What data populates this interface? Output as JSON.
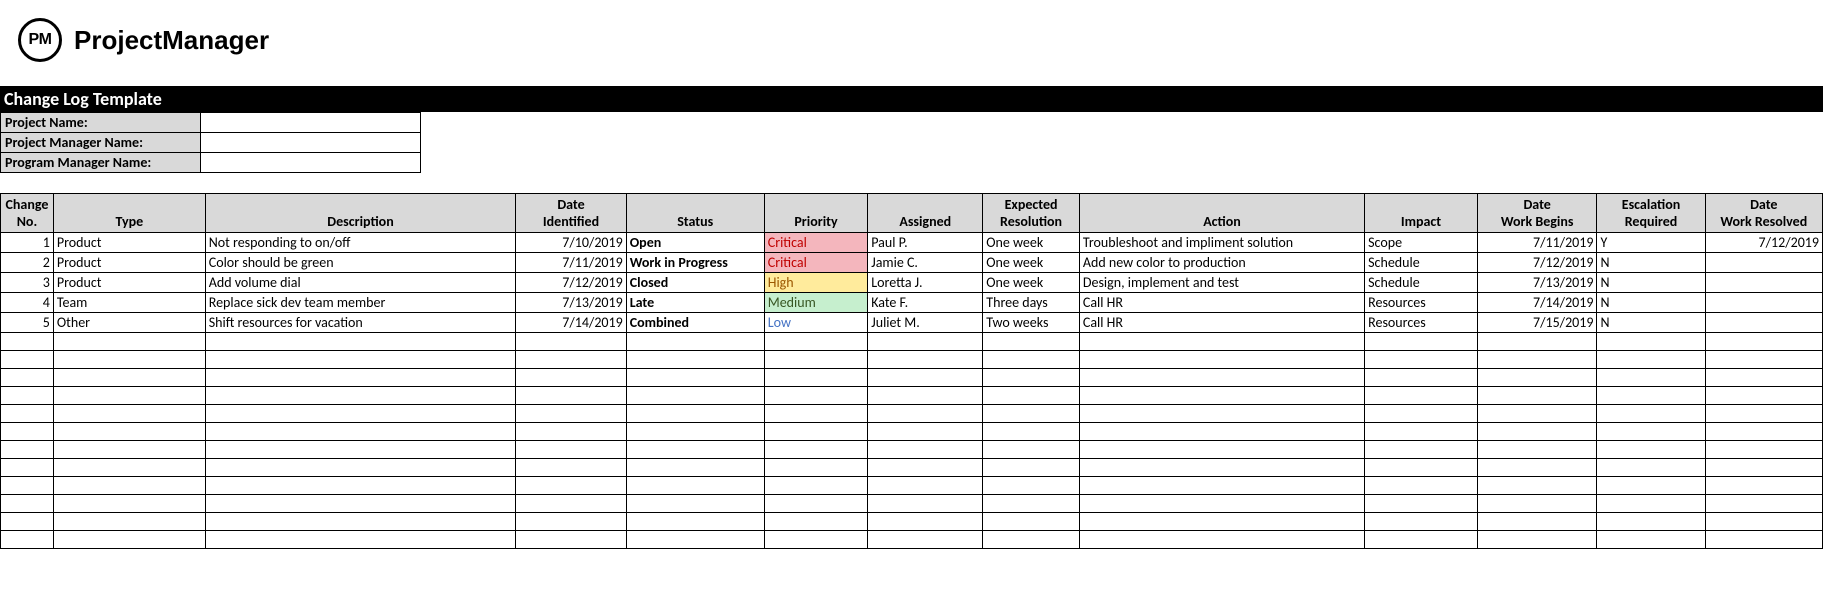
{
  "brand": {
    "logoText": "PM",
    "name": "ProjectManager"
  },
  "title": "Change Log Template",
  "meta": {
    "fields": [
      {
        "label": "Project Name:",
        "value": ""
      },
      {
        "label": "Project Manager Name:",
        "value": ""
      },
      {
        "label": "Program Manager Name:",
        "value": ""
      }
    ]
  },
  "columns": [
    "Change No.",
    "Type",
    "Description",
    "Date Identified",
    "Status",
    "Priority",
    "Assigned",
    "Expected Resolution",
    "Action",
    "Impact",
    "Date Work Begins",
    "Escalation Required",
    "Date Work Resolved"
  ],
  "rows": [
    {
      "no": "1",
      "type": "Product",
      "desc": "Not responding to on/off",
      "dateId": "7/10/2019",
      "status": "Open",
      "priority": "Critical",
      "priClass": "pri-critical",
      "assigned": "Paul P.",
      "expRes": "One week",
      "action": "Troubleshoot and impliment solution",
      "impact": "Scope",
      "dateWB": "7/11/2019",
      "esc": "Y",
      "dateR": "7/12/2019"
    },
    {
      "no": "2",
      "type": "Product",
      "desc": "Color should be green",
      "dateId": "7/11/2019",
      "status": "Work in Progress",
      "priority": "Critical",
      "priClass": "pri-critical",
      "assigned": "Jamie C.",
      "expRes": "One week",
      "action": "Add new color to production",
      "impact": "Schedule",
      "dateWB": "7/12/2019",
      "esc": "N",
      "dateR": ""
    },
    {
      "no": "3",
      "type": "Product",
      "desc": "Add volume dial",
      "dateId": "7/12/2019",
      "status": "Closed",
      "priority": "High",
      "priClass": "pri-high",
      "assigned": "Loretta J.",
      "expRes": "One week",
      "action": "Design, implement and test",
      "impact": "Schedule",
      "dateWB": "7/13/2019",
      "esc": "N",
      "dateR": ""
    },
    {
      "no": "4",
      "type": "Team",
      "desc": "Replace sick dev team member",
      "dateId": "7/13/2019",
      "status": "Late",
      "priority": "Medium",
      "priClass": "pri-medium",
      "assigned": "Kate F.",
      "expRes": "Three days",
      "action": "Call HR",
      "impact": "Resources",
      "dateWB": "7/14/2019",
      "esc": "N",
      "dateR": ""
    },
    {
      "no": "5",
      "type": "Other",
      "desc": "Shift resources for vacation",
      "dateId": "7/14/2019",
      "status": "Combined",
      "priority": "Low",
      "priClass": "pri-low",
      "assigned": "Juliet M.",
      "expRes": "Two weeks",
      "action": "Call HR",
      "impact": "Resources",
      "dateWB": "7/15/2019",
      "esc": "N",
      "dateR": ""
    }
  ],
  "emptyRows": 12
}
